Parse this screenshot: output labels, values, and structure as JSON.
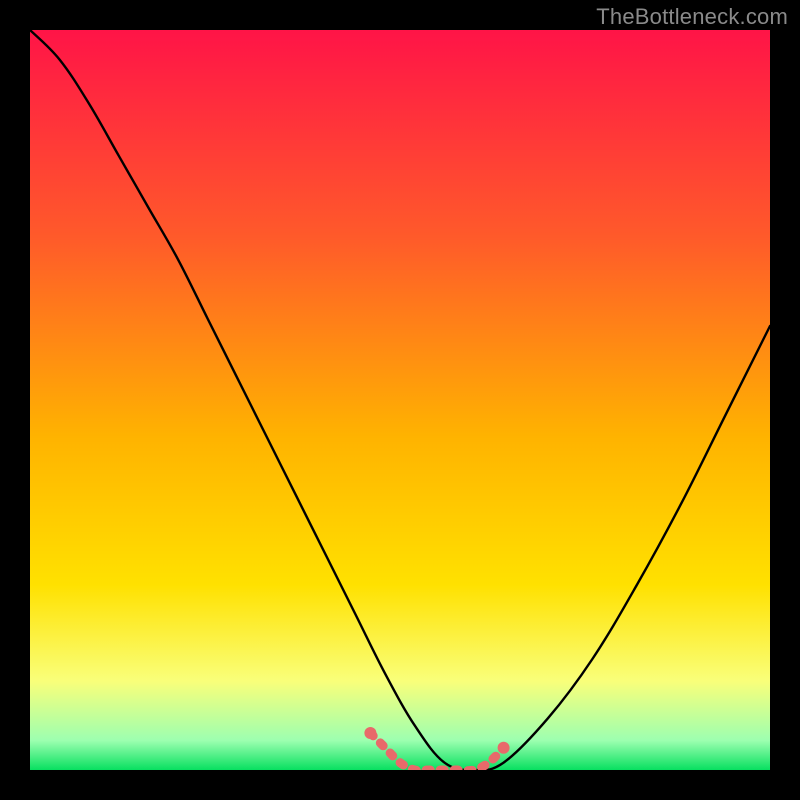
{
  "attribution": "TheBottleneck.com",
  "chart_data": {
    "type": "line",
    "title": "",
    "xlabel": "",
    "ylabel": "",
    "x_range": [
      0,
      100
    ],
    "y_range": [
      0,
      100
    ],
    "gradient_stops": [
      {
        "offset": 0,
        "color": "#ff1447"
      },
      {
        "offset": 0.28,
        "color": "#ff5a2a"
      },
      {
        "offset": 0.55,
        "color": "#ffb300"
      },
      {
        "offset": 0.75,
        "color": "#ffe100"
      },
      {
        "offset": 0.88,
        "color": "#f9ff7a"
      },
      {
        "offset": 0.96,
        "color": "#9dffb0"
      },
      {
        "offset": 1.0,
        "color": "#08e060"
      }
    ],
    "series": [
      {
        "name": "bottleneck-curve",
        "x": [
          0,
          4,
          8,
          12,
          16,
          20,
          24,
          28,
          32,
          36,
          40,
          44,
          48,
          52,
          56,
          60,
          64,
          70,
          76,
          82,
          88,
          94,
          100
        ],
        "values": [
          100,
          96,
          90,
          83,
          76,
          69,
          61,
          53,
          45,
          37,
          29,
          21,
          13,
          6,
          1,
          0,
          1,
          7,
          15,
          25,
          36,
          48,
          60
        ]
      },
      {
        "name": "flat-segment-marker",
        "x": [
          46,
          48,
          50,
          52,
          54,
          56,
          58,
          60,
          62,
          64
        ],
        "values": [
          5,
          3,
          1,
          0,
          0,
          0,
          0,
          0,
          1,
          3
        ]
      }
    ],
    "marker_color": "#e86a6a"
  }
}
